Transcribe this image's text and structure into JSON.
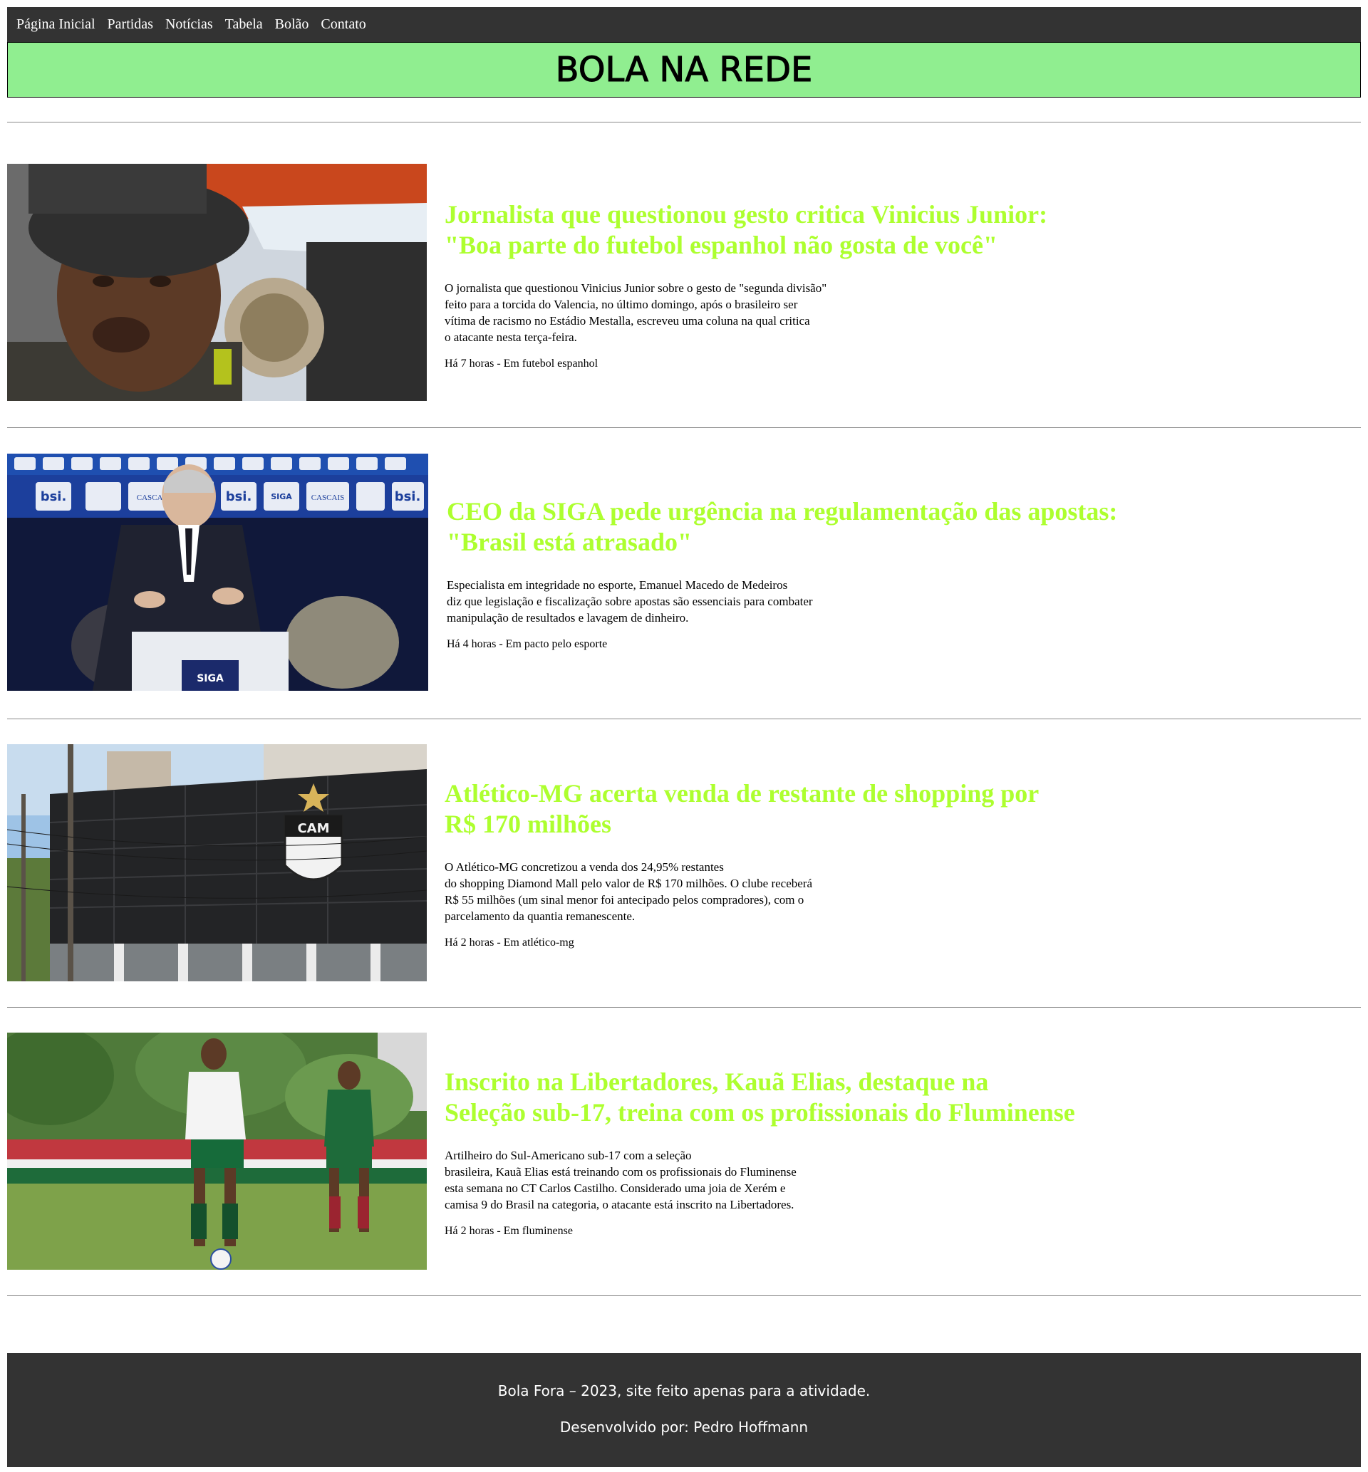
{
  "nav": {
    "items": [
      {
        "label": "Página Inicial"
      },
      {
        "label": "Partidas"
      },
      {
        "label": "Notícias"
      },
      {
        "label": "Tabela"
      },
      {
        "label": "Bolão"
      },
      {
        "label": "Contato"
      }
    ]
  },
  "header": {
    "title": "BOLA NA REDE"
  },
  "articles": [
    {
      "title": "Jornalista que questionou gesto critica Vinicius Junior:\n\"Boa parte do futebol espanhol não gosta de você\"",
      "summary": "O jornalista que questionou Vinicius Junior sobre o gesto de \"segunda divisão\"\nfeito para a torcida do Valencia, no último domingo, após o brasileiro ser\nvítima de racismo no Estádio Mestalla, escreveu uma coluna na qual critica\no atacante nesta terça-feira.",
      "meta": "Há 7 horas - Em futebol espanhol",
      "image": "vinicius-junior-photo"
    },
    {
      "title": "CEO da SIGA pede urgência na regulamentação das apostas:\n\"Brasil está atrasado\"",
      "summary": "Especialista em integridade no esporte, Emanuel Macedo de Medeiros\ndiz que legislação e fiscalização sobre apostas são essenciais para combater\nmanipulação de resultados e lavagem de dinheiro.",
      "meta": "Há 4 horas - Em pacto pelo esporte",
      "image": "siga-ceo-photo",
      "photo_text": {
        "sponsors": [
          "bsi.",
          "CASCAIS",
          "SIGA"
        ],
        "podium": "SIGA"
      }
    },
    {
      "title": "Atlético-MG acerta venda de restante de shopping por\nR$ 170 milhões",
      "summary": "O Atlético-MG concretizou a venda dos 24,95% restantes\ndo shopping Diamond Mall pelo valor de R$ 170 milhões. O clube receberá\nR$ 55 milhões (um sinal menor foi antecipado pelos compradores), com o\nparcelamento da quantia remanescente.",
      "meta": "Há 2 horas - Em atlético-mg",
      "image": "atletico-shopping-photo",
      "photo_text": {
        "crest": "CAM"
      }
    },
    {
      "title": "Inscrito na Libertadores, Kauã Elias, destaque na\nSeleção sub-17, treina com os profissionais do Fluminense",
      "summary": "Artilheiro do Sul-Americano sub-17 com a seleção\nbrasileira, Kauã Elias está treinando com os profissionais do Fluminense\nesta semana no CT Carlos Castilho. Considerado uma joia de Xerém e\ncamisa 9 do Brasil na categoria, o atacante está inscrito na Libertadores.",
      "meta": "Há 2 horas - Em fluminense",
      "image": "fluminense-training-photo"
    }
  ],
  "footer": {
    "line1": "Bola Fora – 2023, site feito apenas para a atividade.",
    "line2": "Desenvolvido por: Pedro Hoffmann"
  },
  "colors": {
    "nav_bg": "#333333",
    "banner_bg": "#90ee90",
    "headline": "#adff2f",
    "footer_bg": "#333333"
  }
}
